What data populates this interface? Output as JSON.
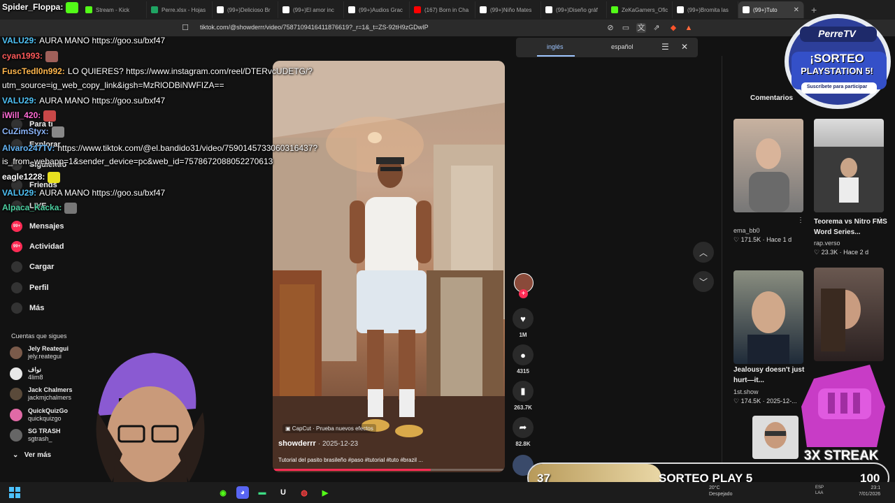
{
  "browser": {
    "tabs": [
      {
        "label": "Stream - Kick",
        "color": "#53fc18"
      },
      {
        "label": "Perre.xlsx - Hojas",
        "color": "#1fa463"
      },
      {
        "label": "(99+)Delicioso Br",
        "color": "#ffffff"
      },
      {
        "label": "(99+)El amor inc",
        "color": "#ffffff"
      },
      {
        "label": "(99+)Audios Grac",
        "color": "#ffffff"
      },
      {
        "label": "(167) Born in Cha",
        "color": "#ff0000"
      },
      {
        "label": "(99+)Niño Mates",
        "color": "#ffffff"
      },
      {
        "label": "(99+)Diseño gráf",
        "color": "#ffffff"
      },
      {
        "label": "ZeKaGamers_Ofic",
        "color": "#53fc18"
      },
      {
        "label": "(99+)Bromita las",
        "color": "#ffffff"
      },
      {
        "label": "(99+)Tuto",
        "color": "#ffffff"
      }
    ],
    "url": "tiktok.com/@showderrr/video/7587109416411876619?_r=1&_t=ZS-92tH9zGDwIP",
    "translate": {
      "lang_a": "inglés",
      "lang_b": "español"
    }
  },
  "sidebar": {
    "items": [
      {
        "label": "Para ti",
        "icon": "home-icon"
      },
      {
        "label": "Explorar",
        "icon": "compass-icon"
      },
      {
        "label": "Siguiendo",
        "icon": "following-icon"
      },
      {
        "label": "Friends",
        "icon": "friends-icon"
      },
      {
        "label": "LIVE",
        "icon": "live-icon"
      },
      {
        "label": "Mensajes",
        "icon": "messages-icon",
        "badge": "99+"
      },
      {
        "label": "Actividad",
        "icon": "activity-icon",
        "badge": "99+"
      },
      {
        "label": "Cargar",
        "icon": "upload-icon"
      },
      {
        "label": "Perfil",
        "icon": "profile-icon"
      },
      {
        "label": "Más",
        "icon": "more-icon"
      }
    ],
    "following_heading": "Cuentas que sigues",
    "following": [
      {
        "name": "Jely Reategui",
        "handle": "jely.reategui",
        "color": "#7a5a4a"
      },
      {
        "name": "نواف",
        "handle": "4lim8",
        "color": "#e8e8e8"
      },
      {
        "name": "Jack Chalmers",
        "handle": "jackmjchalmers",
        "color": "#5a4a3a"
      },
      {
        "name": "QuickQuizGo",
        "handle": "quickquizgo",
        "color": "#e06aa6"
      },
      {
        "name": "SG TRASH",
        "handle": "sgtrash_",
        "color": "#666666"
      }
    ],
    "see_more": "Ver más"
  },
  "video": {
    "capcut": "CapCut · Prueba nuevos efectos",
    "author": "showderrr",
    "date": "· 2025-12-23",
    "caption": "Tutorial del pasito brasileño #paso #tutorial #tuto #brazil ...",
    "progress": 0.68
  },
  "actions": {
    "likes": "1M",
    "comments": "4315",
    "saves": "263.7K",
    "shares": "82.8K"
  },
  "right_panel": {
    "tab": "Comentarios",
    "videos": [
      {
        "title": "",
        "user": "ema_bb0",
        "meta": "♡ 171.5K · Hace 1 d"
      },
      {
        "title": "Teorema vs Nitro FMS Word Series...",
        "user": "rap.verso",
        "meta": "♡ 23.3K · Hace 2 d"
      },
      {
        "title": "Jealousy doesn't just hurt—it...",
        "user": "1st.show",
        "meta": "♡ 174.5K · 2025-12-..."
      }
    ]
  },
  "chat": [
    {
      "user": "Spider_Floppa:",
      "msg": "",
      "color": "#ffffff",
      "emote": "#53fc18"
    },
    {
      "user": "VALU29:",
      "msg": "AURA MANO https://goo.su/bxf47",
      "color": "#4fc3f7"
    },
    {
      "user": "cyan1993:",
      "msg": "",
      "color": "#ff5a5a",
      "emote": "#a0605a"
    },
    {
      "user": "FuscTedl0n992:",
      "msg": "LO QUIERES? https://www.instagram.com/reel/DTERvcUDETG/?",
      "color": "#ffb74d"
    },
    {
      "user": "",
      "msg": "utm_source=ig_web_copy_link&igsh=MzRlODBiNWFIZA==",
      "color": "#ffffff"
    },
    {
      "user": "VALU29:",
      "msg": "AURA MANO https://goo.su/bxf47",
      "color": "#4fc3f7"
    },
    {
      "user": "iWill_420:",
      "msg": "",
      "color": "#ff6ad5",
      "emote": "#c84848"
    },
    {
      "user": "CuZimStyx:",
      "msg": "",
      "color": "#8ab4f8",
      "emote": "#888888"
    },
    {
      "user": "Alvaro247Tv:",
      "msg": "https://www.tiktok.com/@el.bandido31/video/7590145733060316437?",
      "color": "#64b5f6"
    },
    {
      "user": "",
      "msg": "is_from_webapp=1&sender_device=pc&web_id=7578672088052270613",
      "color": "#ffffff"
    },
    {
      "user": "eagle1228:",
      "msg": "",
      "color": "#ffffff",
      "emote": "#e8e020"
    },
    {
      "user": "VALU29:",
      "msg": "AURA MANO https://goo.su/bxf47",
      "color": "#4fc3f7"
    },
    {
      "user": "Alpaca_Kacka:",
      "msg": "",
      "color": "#4dd0a1",
      "emote": "#777777"
    }
  ],
  "overlay": {
    "logo_brand": "PerreTV",
    "logo_line1": "¡SORTEO",
    "logo_line2": "PLAYSTATION 5!",
    "logo_sub": "Suscríbete para participar",
    "streak_left": "37",
    "streak_title": "SORTEO PLAY 5",
    "streak_right": "100",
    "streak_fill": 0.37,
    "streak_label": "3X STREAK"
  },
  "taskbar": {
    "weather_temp": "20°C",
    "weather_desc": "Despejado",
    "lang": "ESP",
    "lang2": "LAA",
    "time": "23:1",
    "date": "7/01/2026"
  }
}
